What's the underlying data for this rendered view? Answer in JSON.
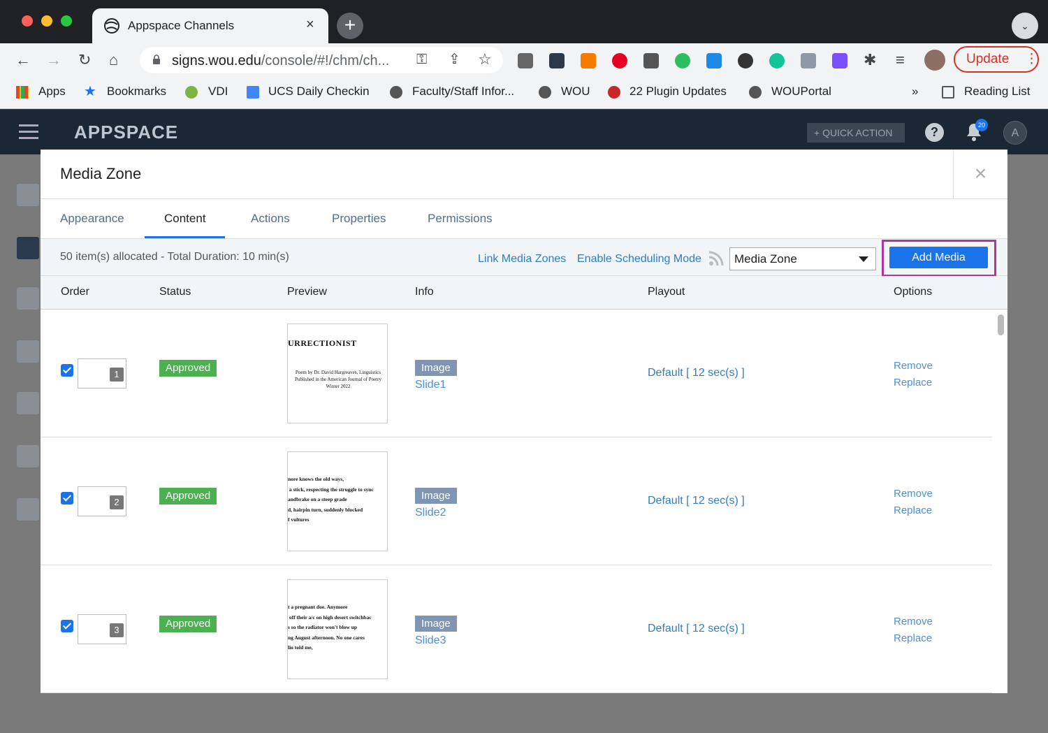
{
  "browser": {
    "tab_title": "Appspace Channels",
    "tab_close": "×",
    "new_tab": "+",
    "chrome_menu": "⌄",
    "url_host": "signs.wou.edu",
    "url_path": "/console/#!/chm/ch...",
    "update_label": "Update",
    "update_more": "⋮",
    "nav": {
      "back": "←",
      "forward": "→",
      "reload": "↻",
      "home": "⌂",
      "key": "⚿",
      "share": "⇪",
      "star": "☆",
      "puzzle": "✱",
      "queue": "≡"
    },
    "bookmarks": [
      {
        "label": "Apps"
      },
      {
        "label": "Bookmarks"
      },
      {
        "label": "VDI"
      },
      {
        "label": "UCS Daily Checkin"
      },
      {
        "label": "Faculty/Staff Infor..."
      },
      {
        "label": "WOU"
      },
      {
        "label": "22 Plugin Updates"
      },
      {
        "label": "WOUPortal"
      }
    ],
    "bookmarks_more": "»",
    "reading_list": "Reading List"
  },
  "app": {
    "logo": "APPSPACE",
    "quick_action": "+ QUICK ACTION",
    "help": "?",
    "notifications_count": "20",
    "avatar_initial": "A"
  },
  "modal": {
    "title": "Media Zone",
    "close": "×",
    "tabs": [
      "Appearance",
      "Content",
      "Actions",
      "Properties",
      "Permissions"
    ],
    "active_tab": "Content",
    "allocation_text": "50 item(s) allocated - Total Duration: 10 min(s)",
    "link_media_zones": "Link Media Zones",
    "enable_scheduling": "Enable Scheduling Mode",
    "zone_select": "Media Zone",
    "add_media": "Add Media",
    "columns": [
      "Order",
      "Status",
      "Preview",
      "Info",
      "Playout",
      "Options"
    ],
    "rows": [
      {
        "order": "1",
        "status": "Approved",
        "preview_heading": "URRECTIONIST",
        "preview_body": "Poem by Dr. David Hargreaves, Linguistics\nPublished in the American Journal of Poetry\nWinter 2022",
        "type": "Image",
        "name": "Slide1",
        "playout": "Default [ 12 sec(s) ]",
        "remove": "Remove",
        "replace": "Replace"
      },
      {
        "order": "2",
        "status": "Approved",
        "preview_lines": "nore knows the old ways,\n a stick, respecting the struggle to sync\nandbrake on a steep grade\nd, hairpin turn, suddenly blocked\nf vultures",
        "type": "Image",
        "name": "Slide2",
        "playout": "Default [ 12 sec(s) ]",
        "remove": "Remove",
        "replace": "Replace"
      },
      {
        "order": "3",
        "status": "Approved",
        "preview_lines": "t a pregnant doe. Anymore\n off their a/c on high desert switchbac\ns so the radiator won't blow up\nng August afternoon. No one cares\nlio told me,",
        "type": "Image",
        "name": "Slide3",
        "playout": "Default [ 12 sec(s) ]",
        "remove": "Remove",
        "replace": "Replace"
      }
    ]
  },
  "colors": {
    "accent": "#1a73e8",
    "approved": "#4caf50",
    "link": "#2f7dc1",
    "highlight": "#b0369a",
    "app_header": "#1b2735"
  }
}
